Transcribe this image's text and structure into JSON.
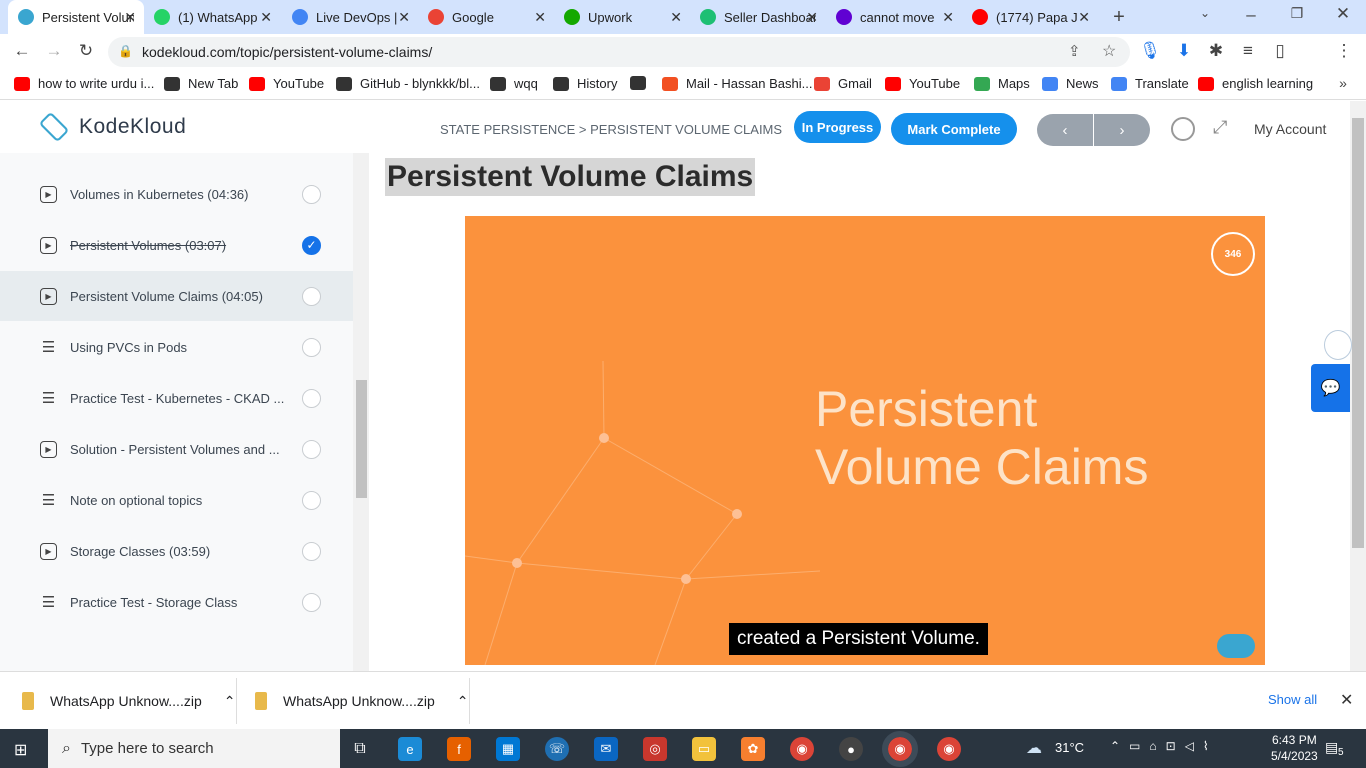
{
  "browser": {
    "tabs": [
      {
        "title": "Persistent Volume Claims",
        "active": true,
        "favicon_color": "#3aa6d0"
      },
      {
        "title": "(1) WhatsApp",
        "active": false,
        "favicon_color": "#25d366"
      },
      {
        "title": "Live DevOps |",
        "active": false,
        "favicon_color": "#4285f4"
      },
      {
        "title": "Google",
        "active": false,
        "favicon_color": "#ea4335"
      },
      {
        "title": "Upwork",
        "active": false,
        "favicon_color": "#14a800"
      },
      {
        "title": "Seller Dashboard",
        "active": false,
        "favicon_color": "#1dbf73"
      },
      {
        "title": "cannot move",
        "active": false,
        "favicon_color": "#6001d2"
      },
      {
        "title": "(1774) Papa J",
        "active": false,
        "favicon_color": "#ff0000"
      }
    ],
    "url": "kodekloud.com/topic/persistent-volume-claims/",
    "bookmarks": [
      {
        "label": "how to write urdu i...",
        "color": "#ff0000"
      },
      {
        "label": "New Tab",
        "color": "#333333"
      },
      {
        "label": "YouTube",
        "color": "#ff0000"
      },
      {
        "label": "GitHub - blynkkk/bl...",
        "color": "#333333"
      },
      {
        "label": "wqq",
        "color": "#333333"
      },
      {
        "label": "History",
        "color": "#333333"
      },
      {
        "label": "",
        "color": "#333333"
      },
      {
        "label": "Mail - Hassan Bashi...",
        "color": "#f25022"
      },
      {
        "label": "Gmail",
        "color": "#ea4335"
      },
      {
        "label": "YouTube",
        "color": "#ff0000"
      },
      {
        "label": "Maps",
        "color": "#34a853"
      },
      {
        "label": "News",
        "color": "#4285f4"
      },
      {
        "label": "Translate",
        "color": "#4285f4"
      },
      {
        "label": "english learning",
        "color": "#ff0000"
      }
    ]
  },
  "header": {
    "logo_text": "KodeKloud",
    "breadcrumb": "STATE PERSISTENCE > PERSISTENT VOLUME CLAIMS",
    "status_label": "In Progress",
    "complete_label": "Mark Complete",
    "prev_icon": "‹",
    "next_icon": "›",
    "account_label": "My Account"
  },
  "sidebar": {
    "items": [
      {
        "label": "Volumes in Kubernetes (04:36)",
        "type": "video",
        "done": false,
        "selected": false
      },
      {
        "label": "Persistent Volumes (03:07)",
        "type": "video",
        "done": true,
        "selected": false
      },
      {
        "label": "Persistent Volume Claims (04:05)",
        "type": "video",
        "done": false,
        "selected": true
      },
      {
        "label": "Using PVCs in Pods",
        "type": "doc",
        "done": false,
        "selected": false
      },
      {
        "label": "Practice Test - Kubernetes - CKAD ...",
        "type": "doc",
        "done": false,
        "selected": false
      },
      {
        "label": "Solution - Persistent Volumes and ...",
        "type": "video",
        "done": false,
        "selected": false
      },
      {
        "label": "Note on optional topics",
        "type": "doc",
        "done": false,
        "selected": false
      },
      {
        "label": "Storage Classes (03:59)",
        "type": "video",
        "done": false,
        "selected": false
      },
      {
        "label": "Practice Test - Storage Class",
        "type": "doc",
        "done": false,
        "selected": false
      }
    ]
  },
  "main": {
    "title": "Persistent Volume Claims",
    "video_heading_line1": "Persistent",
    "video_heading_line2": "Volume Claims",
    "video_badge": "346",
    "caption": "created a Persistent Volume."
  },
  "downloads": {
    "items": [
      {
        "label": "WhatsApp Unknow....zip"
      },
      {
        "label": "WhatsApp Unknow....zip"
      }
    ],
    "show_all": "Show all"
  },
  "taskbar": {
    "search_placeholder": "Type here to search",
    "weather": "31°C",
    "time": "6:43 PM",
    "date": "5/4/2023",
    "notification_count": "5"
  }
}
